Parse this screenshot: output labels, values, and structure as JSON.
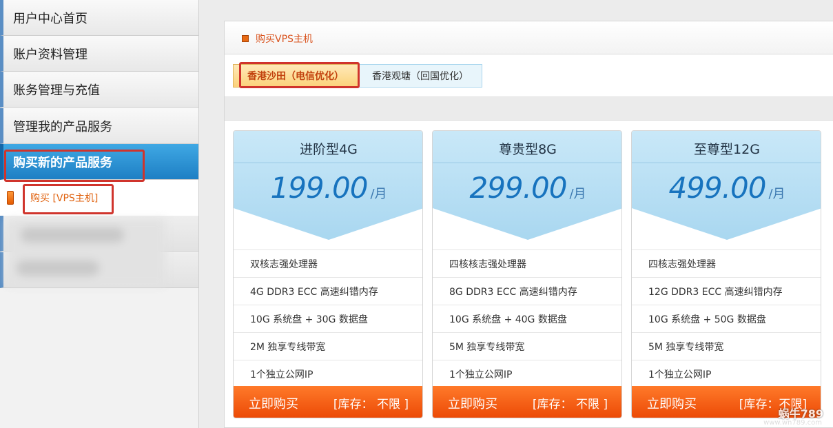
{
  "sidebar": {
    "items": [
      {
        "label": "用户中心首页"
      },
      {
        "label": "账户资料管理"
      },
      {
        "label": "账务管理与充值"
      },
      {
        "label": "管理我的产品服务"
      },
      {
        "label": "购买新的产品服务"
      }
    ],
    "sub_item": {
      "label": "购买 [VPS主机]"
    }
  },
  "panel": {
    "title": "购买VPS主机"
  },
  "regions": [
    {
      "label": "香港沙田（电信优化）",
      "active": true
    },
    {
      "label": "香港观塘（回国优化）",
      "active": false
    }
  ],
  "products": [
    {
      "name": "进阶型4G",
      "price": "199.00",
      "unit": "/月",
      "features": [
        "双核志强处理器",
        "4G DDR3 ECC 高速纠错内存",
        "10G 系统盘 + 30G 数据盘",
        "2M 独享专线带宽",
        "1个独立公网IP"
      ],
      "buy_label": "立即购买",
      "stock_label": "[库存： 不限 ]"
    },
    {
      "name": "尊贵型8G",
      "price": "299.00",
      "unit": "/月",
      "features": [
        "四核核志强处理器",
        "8G DDR3 ECC 高速纠错内存",
        "10G 系统盘 + 40G 数据盘",
        "5M 独享专线带宽",
        "1个独立公网IP"
      ],
      "buy_label": "立即购买",
      "stock_label": "[库存： 不限 ]"
    },
    {
      "name": "至尊型12G",
      "price": "499.00",
      "unit": "/月",
      "features": [
        "四核志强处理器",
        "12G DDR3 ECC 高速纠错内存",
        "10G 系统盘 + 50G 数据盘",
        "5M 独享专线带宽",
        "1个独立公网IP"
      ],
      "buy_label": "立即购买",
      "stock_label": "[库存：不限]"
    }
  ],
  "watermark": {
    "text": "蜗牛789",
    "url": "www.wn789.com"
  },
  "colors": {
    "accent_blue": "#1e7fc4",
    "price_blue": "#1773be",
    "buy_orange": "#ec4a06",
    "highlight_red": "#d0342c",
    "title_orange": "#d9531e"
  }
}
